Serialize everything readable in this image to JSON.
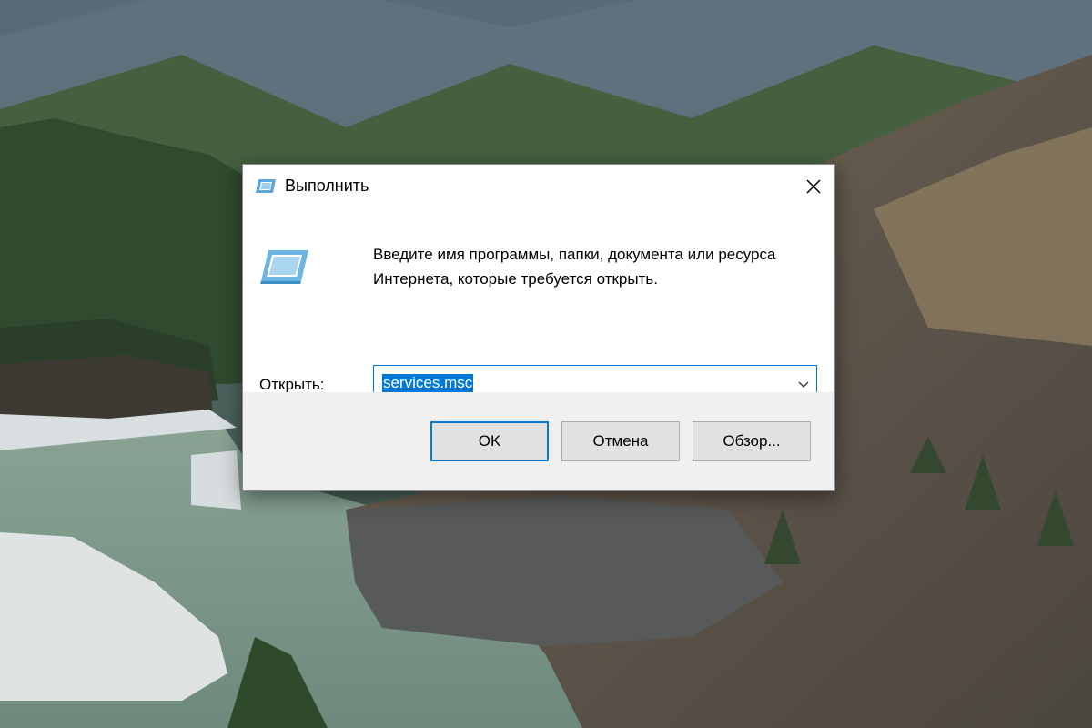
{
  "window": {
    "title": "Выполнить",
    "close_icon": "close-icon"
  },
  "content": {
    "icon": "run-icon",
    "description": "Введите имя программы, папки, документа или ресурса Интернета, которые требуется открыть.",
    "open_label": "Открыть:",
    "input_value": "services.msc",
    "dropdown_icon": "chevron-down-icon"
  },
  "buttons": {
    "ok": "OK",
    "cancel": "Отмена",
    "browse": "Обзор..."
  },
  "colors": {
    "accent": "#0078d7",
    "footer_bg": "#f0f0f0",
    "button_bg": "#e1e1e1"
  }
}
